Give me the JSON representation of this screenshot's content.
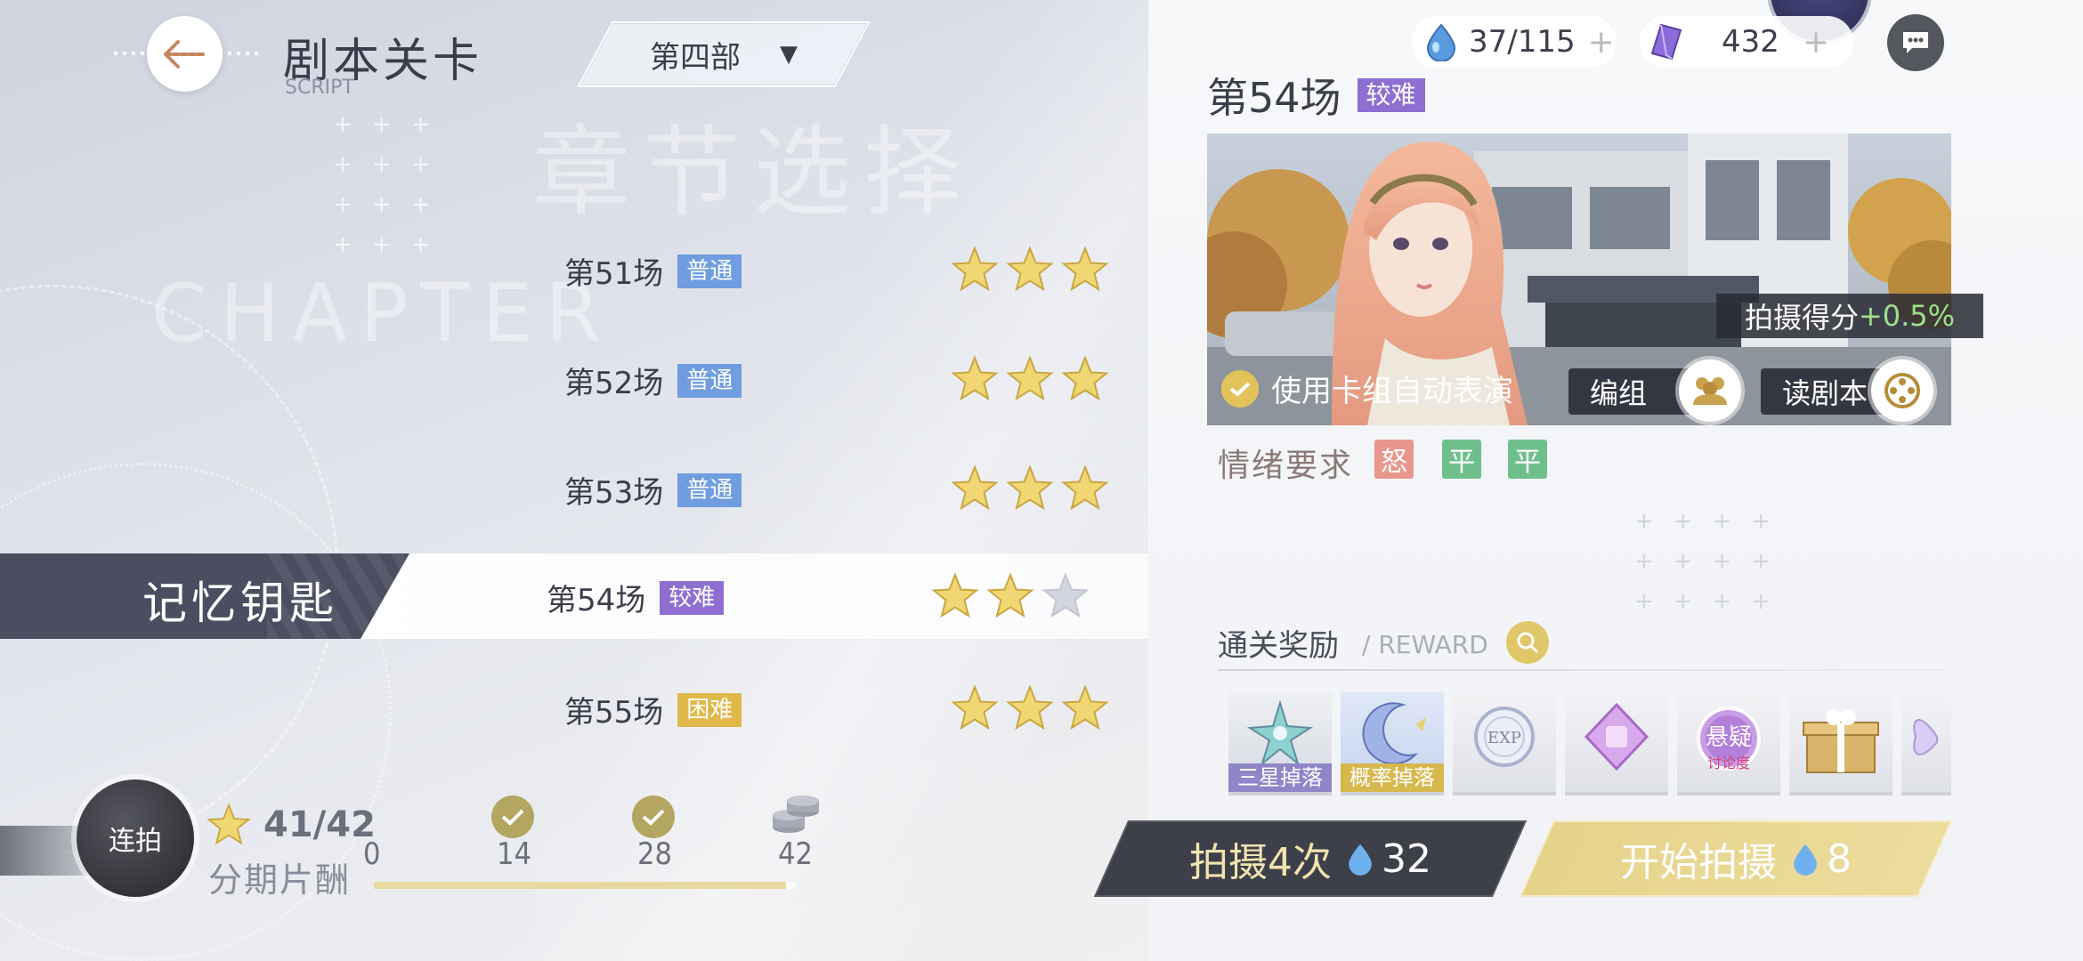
{
  "header": {
    "title": "剧本关卡",
    "subtitle": "SCRIPT",
    "part_selector": "第四部",
    "bg_title": "章节选择",
    "bg_chapter": "CHAPTER"
  },
  "stages": [
    {
      "name": "第51场",
      "difficulty": "普通",
      "diff_color": "#6f9de0",
      "stars": 3
    },
    {
      "name": "第52场",
      "difficulty": "普通",
      "diff_color": "#6f9de0",
      "stars": 3
    },
    {
      "name": "第53场",
      "difficulty": "普通",
      "diff_color": "#6f9de0",
      "stars": 3
    },
    {
      "name": "第54场",
      "difficulty": "较难",
      "diff_color": "#8e6fd1",
      "stars": 2
    },
    {
      "name": "第55场",
      "difficulty": "困难",
      "diff_color": "#e0b84a",
      "stars": 3
    }
  ],
  "memory_key_label": "记忆钥匙",
  "combo_button": "连拍",
  "installment": {
    "star_count": "41/42",
    "label": "分期片酬",
    "milestones": [
      "0",
      "14",
      "28",
      "42"
    ],
    "progress": 0.976
  },
  "resources": {
    "energy": "37/115",
    "crystal": "432"
  },
  "detail": {
    "stage_title": "第54场",
    "difficulty": "较难",
    "score_bonus_label": "拍摄得分",
    "score_bonus_value": "+0.5%",
    "auto_play_label": "使用卡组自动表演",
    "team_button": "编组",
    "read_script_button": "读剧本",
    "emotion_label": "情绪要求",
    "emotions": [
      {
        "text": "怒",
        "color": "#e9978d"
      },
      {
        "text": "平",
        "color": "#6fbf8d"
      },
      {
        "text": "平",
        "color": "#6fbf8d"
      }
    ],
    "reward_title": "通关奖励",
    "reward_sub": "/ REWARD",
    "rewards": [
      {
        "icon": "star-crystal-icon",
        "tag": "三星掉落",
        "tag_color": "#8f86c8"
      },
      {
        "icon": "moon-charm-icon",
        "tag": "概率掉落",
        "tag_color": "#d6b84d"
      },
      {
        "icon": "exp-orb-icon",
        "tag": ""
      },
      {
        "icon": "purple-gem-icon",
        "tag": ""
      },
      {
        "icon": "suspicion-badge-icon",
        "tag": "",
        "text_main": "悬疑",
        "text_sub": "讨论度"
      },
      {
        "icon": "gift-box-icon",
        "tag": ""
      },
      {
        "icon": "butterfly-icon",
        "tag": ""
      }
    ]
  },
  "actions": {
    "multi_shoot_label": "拍摄4次",
    "multi_shoot_cost": "32",
    "start_label": "开始拍摄",
    "start_cost": "8"
  }
}
